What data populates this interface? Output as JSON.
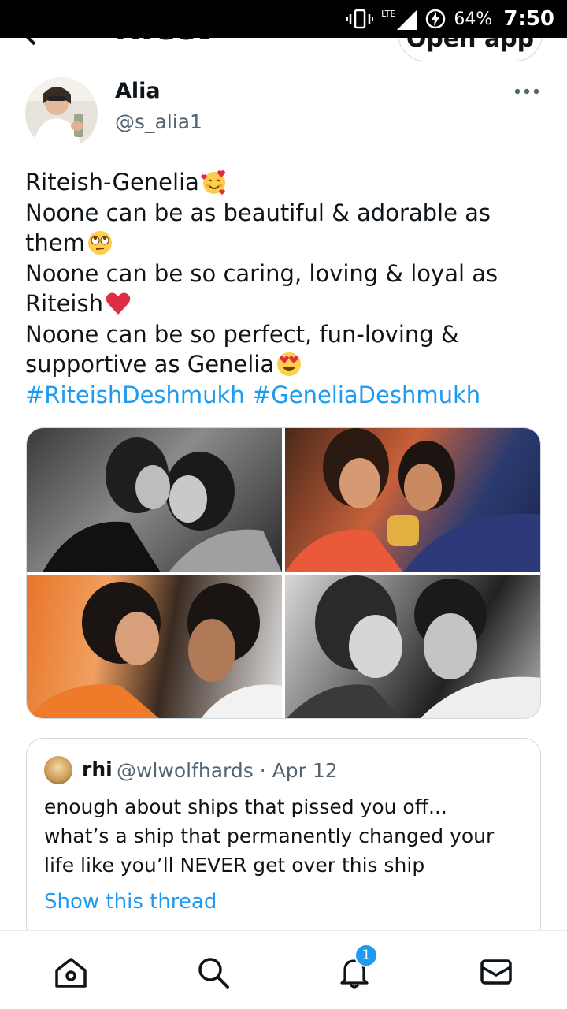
{
  "status_bar": {
    "network": "LTE",
    "battery": "64%",
    "time": "7:50",
    "icons": [
      "vibrate-icon",
      "signal-icon",
      "battery-charging-icon"
    ]
  },
  "header": {
    "title": "Tweet",
    "open_app_label": "Open app"
  },
  "tweet": {
    "author_name": "Alia",
    "author_handle": "@s_alia1",
    "lines": [
      {
        "text": "Riteish-Genelia",
        "emoji": "smiling-face-with-hearts"
      },
      {
        "text": "Noone can be as beautiful & adorable as"
      },
      {
        "text": "them",
        "emoji": "face-with-rolling-eyes"
      },
      {
        "text": "Noone can be so caring, loving & loyal as"
      },
      {
        "text": "Riteish",
        "emoji": "red-heart"
      },
      {
        "text": "Noone can be so perfect, fun-loving &"
      },
      {
        "text": "supportive as Genelia",
        "emoji": "smiling-face-with-heart-eyes"
      }
    ],
    "hashtags": [
      "#RiteishDeshmukh",
      "#GeneliaDeshmukh"
    ],
    "media_count": 4
  },
  "quoted_tweet": {
    "name": "rhi",
    "handle": "@wlwolfhards",
    "separator": "·",
    "date": "Apr 12",
    "lines": [
      "enough about ships that pissed you off...",
      "what’s a ship that permanently changed your",
      "life like you’ll NEVER get over this ship"
    ],
    "show_thread_label": "Show this thread"
  },
  "bottom_nav": {
    "items": [
      "home-icon",
      "search-icon",
      "notifications-icon",
      "messages-icon"
    ],
    "notification_badge": "1"
  },
  "colors": {
    "accent": "#1d9bf0",
    "text": "#0f1419",
    "secondary_text": "#536471",
    "border": "#cfd9de"
  }
}
